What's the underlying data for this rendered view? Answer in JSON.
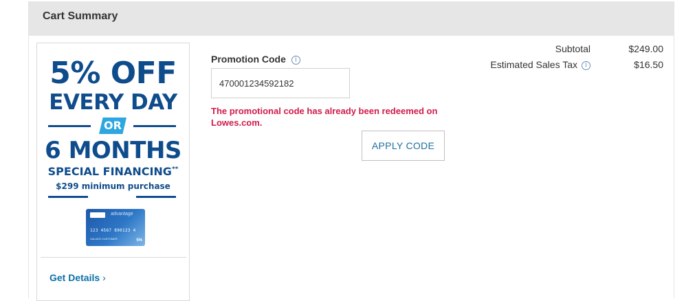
{
  "header": {
    "title": "Cart Summary"
  },
  "promo_banner": {
    "line1": "5% OFF",
    "line2": "EVERY DAY",
    "or_label": "OR",
    "line3": "6 MONTHS",
    "line4": "SPECIAL FINANCING",
    "line4_sup": "**",
    "line5": "$299 minimum purchase",
    "card": {
      "brand": "advantage",
      "number": "123 4567 890123 4",
      "holder": "VALUED CUSTOMER",
      "badge": "5%"
    },
    "get_details_label": "Get Details",
    "accent_color": "#0f4c8c",
    "or_color": "#2ea6df"
  },
  "promotion": {
    "label": "Promotion Code",
    "info_icon": "info-icon",
    "code_value": "470001234592182",
    "error_message": "The promotional code has already been redeemed on Lowes.com.",
    "error_color": "#d11a4a",
    "apply_label": "APPLY CODE"
  },
  "totals": {
    "subtotal_label": "Subtotal",
    "subtotal_value": "$249.00",
    "tax_label": "Estimated Sales Tax",
    "tax_value": "$16.50"
  }
}
